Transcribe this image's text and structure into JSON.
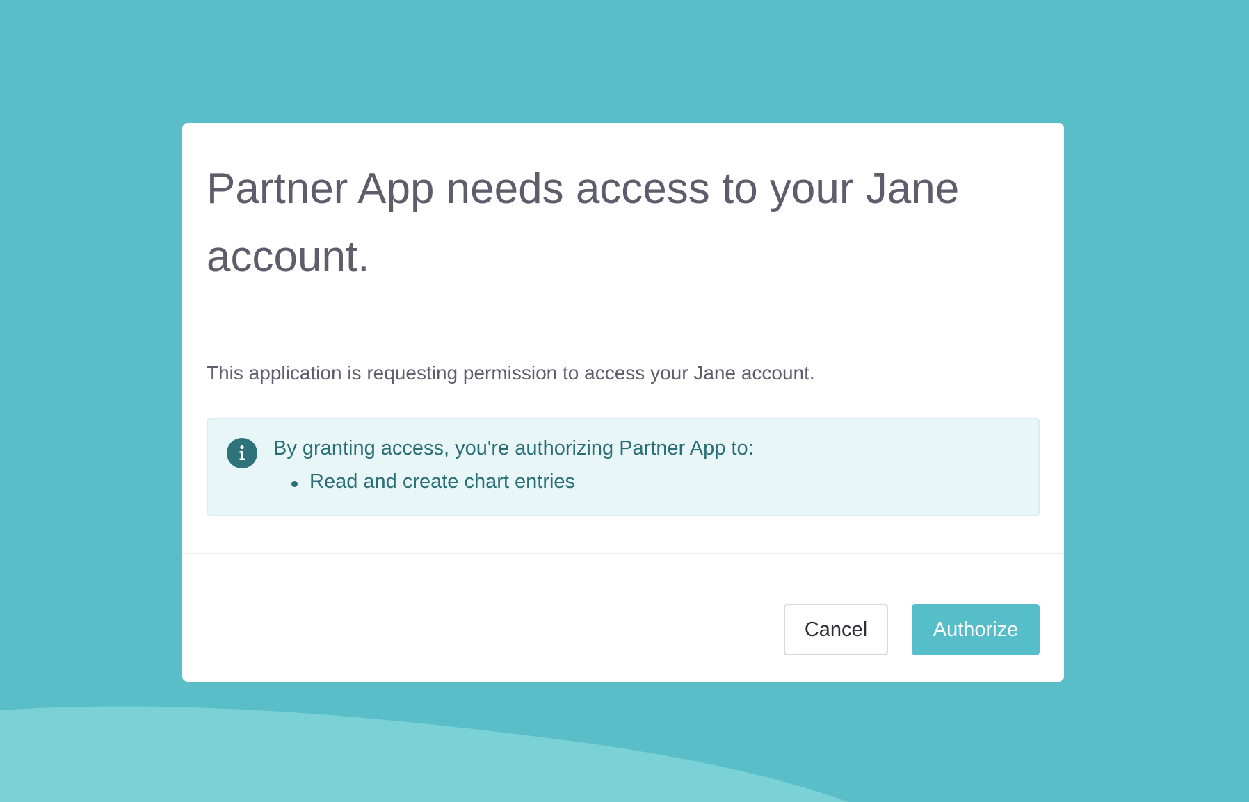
{
  "colors": {
    "background": "#5abec9",
    "wave": "#7ad1d6",
    "modal_bg": "#ffffff",
    "title_text": "#5f5d6c",
    "info_bg": "#e9f6f8",
    "info_text": "#2a6e76",
    "info_icon": "#2e727a",
    "primary": "#55bec9"
  },
  "dialog": {
    "title": "Partner App needs access to your Jane account.",
    "intro": "This application is requesting permission to access your Jane account.",
    "info": {
      "icon": "info-icon",
      "heading": "By granting access, you're authorizing Partner App to:",
      "permissions": [
        {
          "label": "Read and create chart entries"
        }
      ]
    },
    "actions": {
      "cancel_label": "Cancel",
      "authorize_label": "Authorize"
    }
  }
}
